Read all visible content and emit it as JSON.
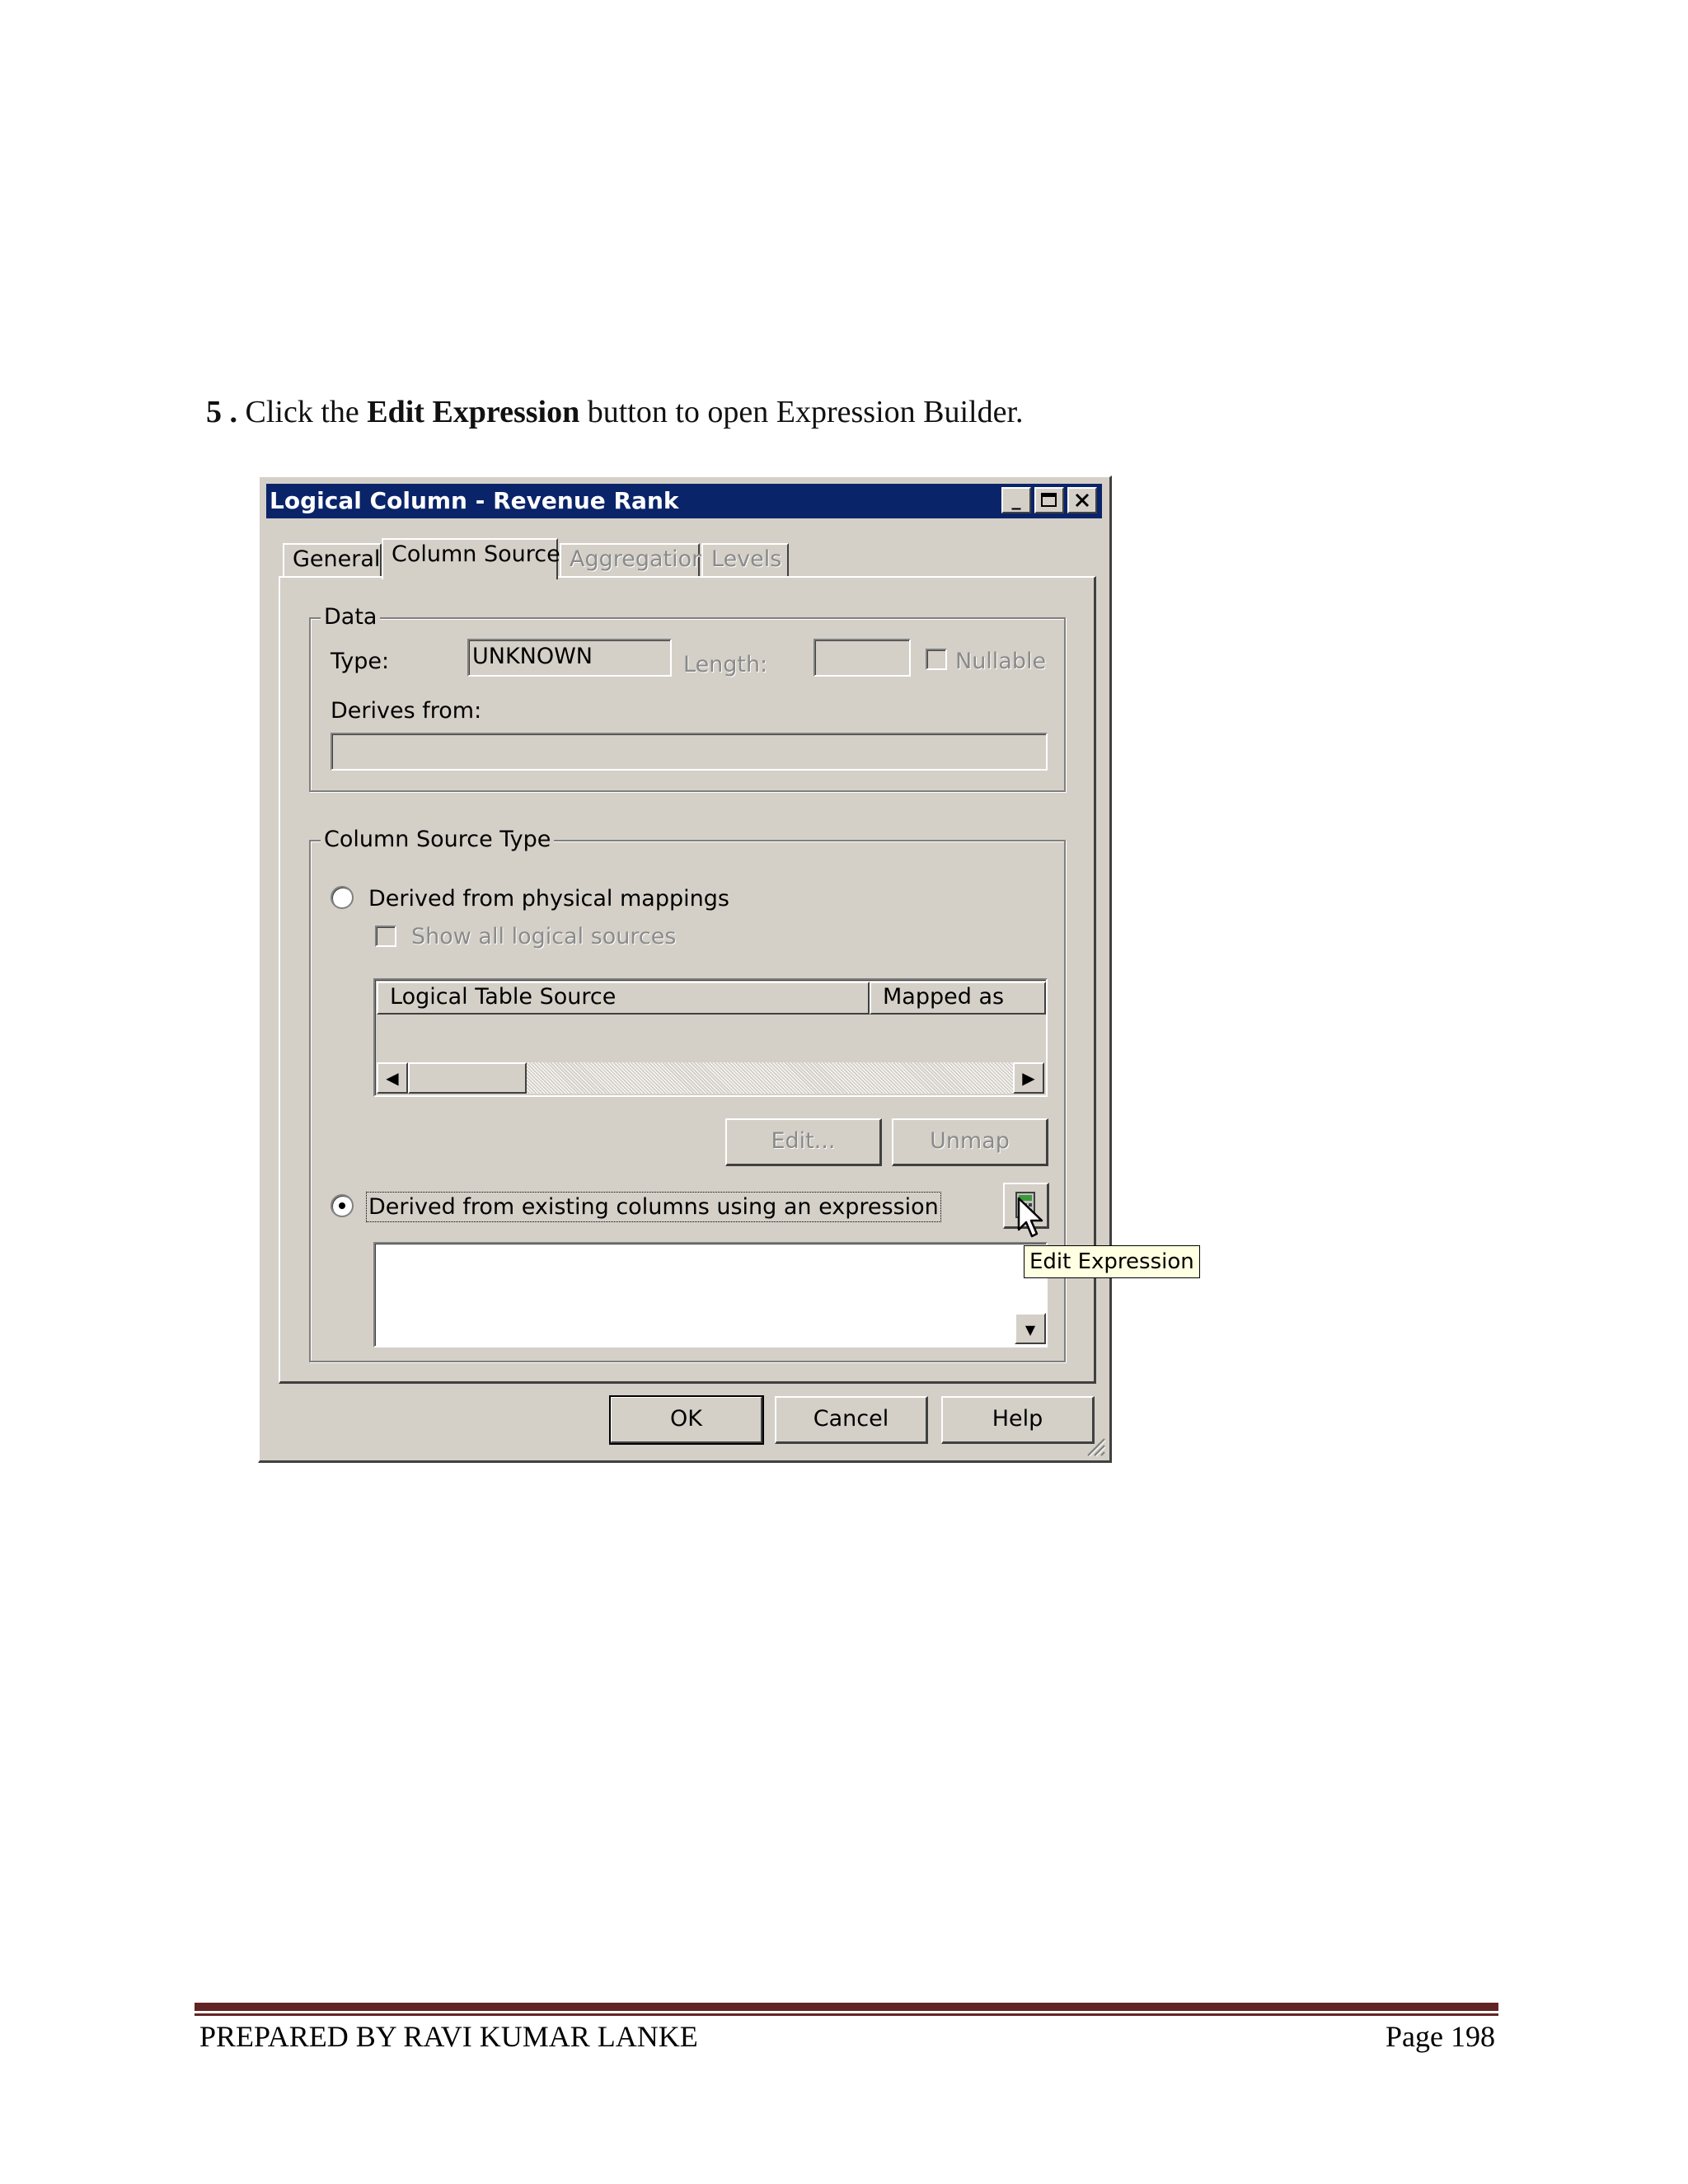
{
  "instruction": {
    "number": "5 .",
    "pre": "Click the",
    "bold": "Edit Expression",
    "post": "button to open Expression Builder."
  },
  "dialog": {
    "title": "Logical Column - Revenue Rank",
    "tabs": [
      {
        "label": "General",
        "state": "normal"
      },
      {
        "label": "Column Source",
        "state": "active"
      },
      {
        "label": "Aggregation",
        "state": "disabled"
      },
      {
        "label": "Levels",
        "state": "disabled"
      }
    ],
    "data_group": {
      "legend": "Data",
      "type_label": "Type:",
      "type_value": "UNKNOWN",
      "length_label": "Length:",
      "length_value": "",
      "nullable_label": "Nullable",
      "derives_label": "Derives from:",
      "derives_value": ""
    },
    "source_group": {
      "legend": "Column Source Type",
      "radio_physical": "Derived from physical mappings",
      "show_all": "Show all logical sources",
      "col_logical_table_source": "Logical Table Source",
      "col_mapped_as": "Mapped as",
      "edit_button": "Edit...",
      "unmap_button": "Unmap",
      "radio_expression": "Derived from existing columns using an expression",
      "expression_value": ""
    },
    "buttons": {
      "ok": "OK",
      "cancel": "Cancel",
      "help": "Help"
    },
    "tooltip": "Edit Expression"
  },
  "footer": {
    "left": "PREPARED BY RAVI KUMAR LANKE",
    "right": "Page 198"
  }
}
